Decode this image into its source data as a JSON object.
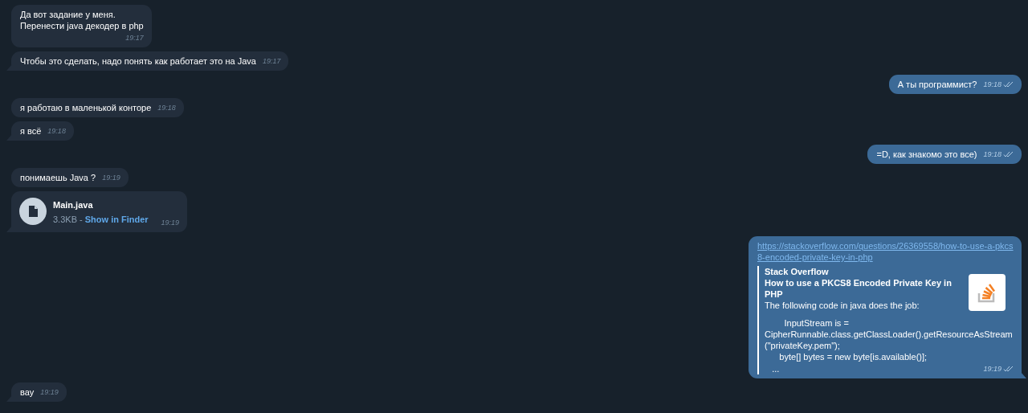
{
  "messages": [
    {
      "kind": "text",
      "outgoing": false,
      "text": "Да вот задание у меня.\nПеренести java декодер в php",
      "time": "19:17",
      "tail": false
    },
    {
      "kind": "text",
      "outgoing": false,
      "text": "Чтобы это сделать, надо понять как работает это на Java",
      "time": "19:17",
      "tail": true
    },
    {
      "kind": "text",
      "outgoing": true,
      "text": "А ты программист?",
      "time": "19:18",
      "read": true,
      "tail": false
    },
    {
      "kind": "text",
      "outgoing": false,
      "text": "я работаю в маленькой конторе",
      "time": "19:18",
      "tail": false
    },
    {
      "kind": "text",
      "outgoing": false,
      "text": "я всё",
      "time": "19:18",
      "tail": true
    },
    {
      "kind": "text",
      "outgoing": true,
      "text": "=D, как знакомо это все)",
      "time": "19:18",
      "read": true,
      "tail": false
    },
    {
      "kind": "text",
      "outgoing": false,
      "text": "понимаешь Java ?",
      "time": "19:19",
      "tail": false
    },
    {
      "kind": "file",
      "outgoing": false,
      "file_name": "Main.java",
      "size": "3.3KB -",
      "action": "Show in Finder",
      "time": "19:19",
      "tail": true
    },
    {
      "kind": "link",
      "outgoing": true,
      "url": "https://stackoverflow.com/questions/26369558/how-to-use-a-pkcs8-encoded-private-key-in-php",
      "site": "Stack Overflow",
      "title": "How to use a PKCS8 Encoded Private Key in PHP",
      "description": "The following code in java does the job:",
      "code": "        InputStream is = CipherRunnable.class.getClassLoader().getResourceAsStream(\"privateKey.pem\");\n      byte[] bytes = new byte[is.available()];",
      "more": "...",
      "time": "19:19",
      "read": true,
      "tail": true
    },
    {
      "kind": "text",
      "outgoing": false,
      "text": "вау",
      "time": "19:19",
      "tail": true
    }
  ]
}
